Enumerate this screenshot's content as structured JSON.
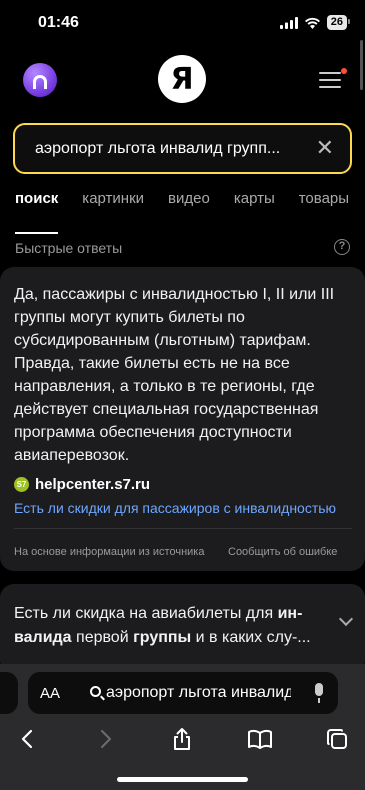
{
  "status": {
    "time": "01:46",
    "battery": "26"
  },
  "header": {
    "logo_letter": "Я"
  },
  "search": {
    "query": "аэропорт льгота инвалид групп..."
  },
  "tabs": [
    {
      "label": "поиск",
      "active": true
    },
    {
      "label": "картинки"
    },
    {
      "label": "видео"
    },
    {
      "label": "карты"
    },
    {
      "label": "товары"
    }
  ],
  "quick_answers": {
    "title": "Быстрые ответы",
    "answer": "Да, пассажиры с инвалидностью I, II или III группы могут купить билеты по субсидированным (льготным) тарифам. Правда, такие билеты есть не на все направления, а только в те регионы, где действует специальная государственная программа обеспечения доступности авиаперевозок.",
    "source_badge": "S7",
    "source_name": "helpcenter.s7.ru",
    "source_link": "Есть ли скидки для пассажиров с инвалидностью",
    "footer": "На основе информации из источника",
    "report": "Сообщить об ошибке"
  },
  "related": {
    "q_part1": "Есть ли скидка на авиабилеты для ",
    "q_bold1": "ин-валида",
    "q_part2": " первой ",
    "q_bold2": "группы",
    "q_part3": " и в каких слу-..."
  },
  "browser": {
    "aa_label": "AA",
    "url_text": "аэропорт льгота инвалид"
  }
}
